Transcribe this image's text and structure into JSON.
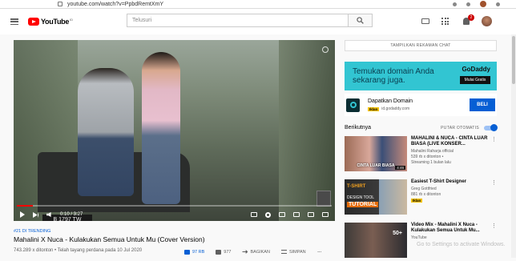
{
  "browser": {
    "url": "youtube.com/watch?v=PpbdRemtXmY"
  },
  "header": {
    "logo_text": "YouTube",
    "logo_suffix": "ID",
    "search_placeholder": "Telusuri",
    "notification_count": "2"
  },
  "player": {
    "plate_text": "B 1797 TW",
    "time": "0:10 / 3:27",
    "progress_fraction": 0.05
  },
  "video": {
    "trending": "#21 DI TRENDING",
    "title": "Mahalini X Nuca - Kulakukan Semua Untuk Mu (Cover Version)",
    "meta": "743.289 x ditonton • Telah tayang perdana pada 10 Jul 2020",
    "likes": "97 RB",
    "dislikes": "977",
    "share_label": "BAGIKAN",
    "save_label": "SIMPAN"
  },
  "sidebar": {
    "chat_button": "TAMPILKAN REKAMAN CHAT",
    "ad_banner_text": "Temukan domain Anda sekarang juga.",
    "ad_banner_brand": "GoDaddy",
    "ad_banner_cta": "Mulai Gratis",
    "ad_card_title": "Dapatkan Domain",
    "ad_card_badge": "Iklan",
    "ad_card_domain": "id.godaddy.com",
    "ad_card_button": "BELI",
    "next_label": "Berikutnya",
    "autoplay_label": "PUTAR OTOMATIS",
    "videos": [
      {
        "title": "MAHALINI & NUCA - CINTA LUAR BIASA (LIVE KONSER...",
        "channel": "Mahalini Raharja official",
        "stats": "539 rb x ditonton •",
        "stats2": "Streaming 1 bulan lalu",
        "duration": "4:46",
        "thumb_text": "CINTA LUAR BIASA"
      },
      {
        "title": "Easiest T-Shirt Designer",
        "channel": "Greg Gottfried",
        "stats": "881 rb x ditonton",
        "badge": "Iklan",
        "thumb_line1": "T-SHIRT",
        "thumb_line2": "DESIGN TOOL",
        "thumb_line3": "TUTORIAL"
      },
      {
        "title": "Video Mix - Mahalini X Nuca - Kulakukan Semua Untuk Mu...",
        "channel": "YouTube",
        "thumb_text": "50+"
      }
    ]
  },
  "watermark": "Go to Settings to activate Windows."
}
